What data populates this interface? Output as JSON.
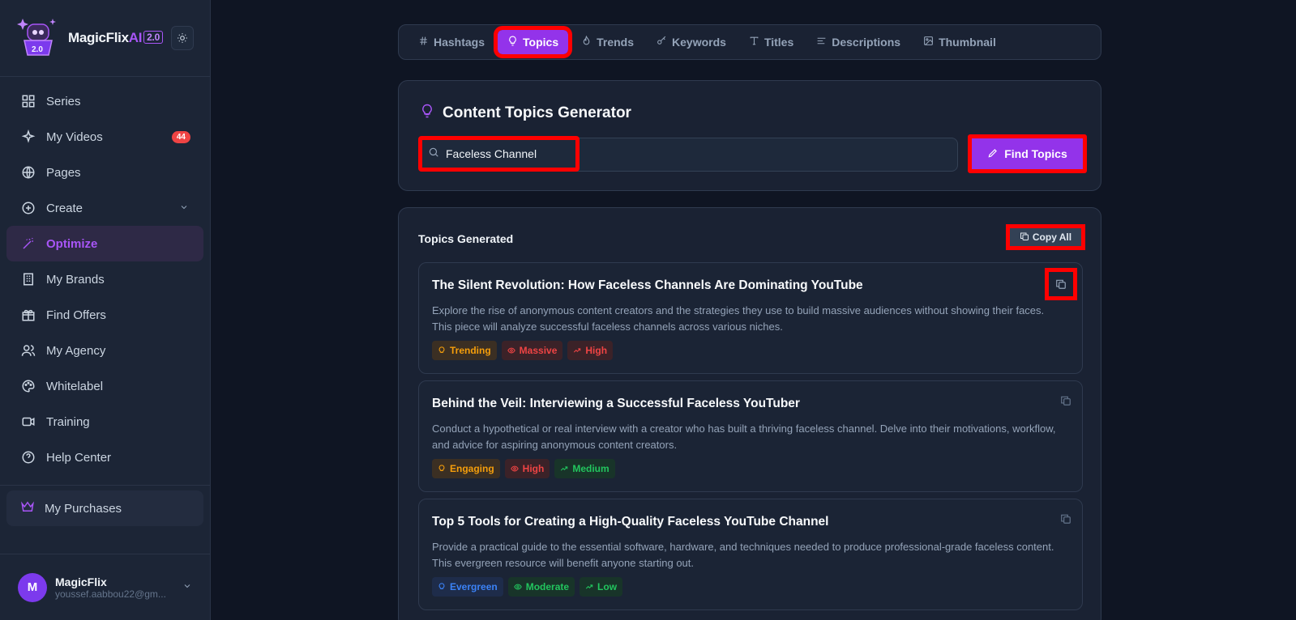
{
  "brand": {
    "name": "MagicFlix",
    "ai": "AI",
    "version": "2.0"
  },
  "sidebar": {
    "items": [
      {
        "label": "Series"
      },
      {
        "label": "My Videos",
        "badge": "44"
      },
      {
        "label": "Pages"
      },
      {
        "label": "Create"
      },
      {
        "label": "Optimize"
      },
      {
        "label": "My Brands"
      },
      {
        "label": "Find Offers"
      },
      {
        "label": "My Agency"
      },
      {
        "label": "Whitelabel"
      },
      {
        "label": "Training"
      },
      {
        "label": "Help Center"
      }
    ],
    "purchases": "My Purchases"
  },
  "user": {
    "initial": "M",
    "name": "MagicFlix",
    "email": "youssef.aabbou22@gm..."
  },
  "tabs": [
    "Hashtags",
    "Topics",
    "Trends",
    "Keywords",
    "Titles",
    "Descriptions",
    "Thumbnail"
  ],
  "generator": {
    "title": "Content Topics Generator",
    "query": "Faceless Channel",
    "button": "Find Topics"
  },
  "results": {
    "heading": "Topics Generated",
    "copy_all": "Copy All",
    "topics": [
      {
        "title": "The Silent Revolution: How Faceless Channels Are Dominating YouTube",
        "desc": "Explore the rise of anonymous content creators and the strategies they use to build massive audiences without showing their faces. This piece will analyze successful faceless channels across various niches.",
        "tags": [
          "Trending",
          "Massive",
          "High"
        ]
      },
      {
        "title": "Behind the Veil: Interviewing a Successful Faceless YouTuber",
        "desc": "Conduct a hypothetical or real interview with a creator who has built a thriving faceless channel. Delve into their motivations, workflow, and advice for aspiring anonymous content creators.",
        "tags": [
          "Engaging",
          "High",
          "Medium"
        ]
      },
      {
        "title": "Top 5 Tools for Creating a High-Quality Faceless YouTube Channel",
        "desc": "Provide a practical guide to the essential software, hardware, and techniques needed to produce professional-grade faceless content. This evergreen resource will benefit anyone starting out.",
        "tags": [
          "Evergreen",
          "Moderate",
          "Low"
        ]
      }
    ]
  },
  "colors": {
    "accent": "#9333ea",
    "highlight": "#ff0000"
  }
}
